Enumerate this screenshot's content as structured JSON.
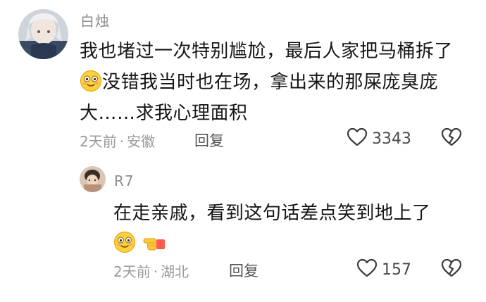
{
  "comments": [
    {
      "username": "白烛",
      "text_line1": "我也堵过一次特别尴尬，最后人家把马桶拆了",
      "text_line2": "没错我当时也在场，拿出来的那屎庞臭庞",
      "text_line3": "大……求我心理面积",
      "time": "2天前",
      "separator": "·",
      "location": "安徽",
      "reply_label": "回复",
      "like_count": "3343",
      "emoji_name": "smiling-emoji"
    },
    {
      "username": "R7",
      "text_line1": "在走亲戚，看到这句话差点笑到地上了",
      "time": "2天前",
      "separator": "·",
      "location": "湖北",
      "reply_label": "回复",
      "like_count": "157",
      "emoji_names": [
        "smiling-emoji",
        "pointing-hand-emoji"
      ]
    }
  ],
  "colors": {
    "meta_text": "#9a9a9a",
    "username": "#8e8e8e",
    "body_text": "#161616",
    "icon_stroke": "#3c3c3c"
  }
}
